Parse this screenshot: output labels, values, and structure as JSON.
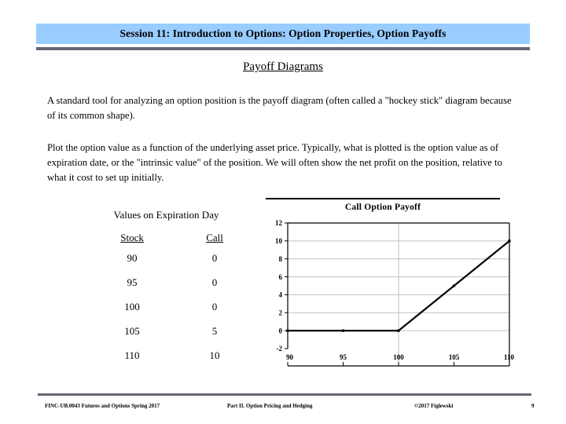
{
  "header": {
    "title": "Session 11:  Introduction to Options: Option Properties, Option Payoffs",
    "banner_color": "#99ccff",
    "rule_color": "#666677"
  },
  "slide": {
    "title": "Payoff Diagrams",
    "paragraphs": [
      "A standard tool for analyzing an option position is the payoff diagram (often called a \"hockey stick\" diagram because of its common shape).",
      "Plot the option value as a function of the underlying asset price.  Typically, what is plotted is the option value as of expiration date, or the \"intrinsic value\" of the position.  We will often show the net profit on the position, relative to what it cost to set up initially."
    ]
  },
  "values_table": {
    "caption": "Values on Expiration Day",
    "columns": [
      "Stock",
      "Call"
    ],
    "rows": [
      [
        "90",
        "0"
      ],
      [
        "95",
        "0"
      ],
      [
        "100",
        "0"
      ],
      [
        "105",
        "5"
      ],
      [
        "110",
        "10"
      ]
    ]
  },
  "chart_data": {
    "type": "line",
    "title": "Call Option Payoff",
    "xlabel": "",
    "ylabel": "",
    "x": [
      90,
      95,
      100,
      105,
      110
    ],
    "values": [
      0,
      0,
      0,
      5,
      10
    ],
    "series": [
      {
        "name": "Call Option Payoff",
        "values": [
          0,
          0,
          0,
          5,
          10
        ]
      }
    ],
    "xlim": [
      90,
      110
    ],
    "ylim": [
      -2,
      12
    ],
    "xticks": [
      90,
      95,
      100,
      105,
      110
    ],
    "xtick_labels": [
      "90",
      "95",
      "100",
      "105",
      "110"
    ],
    "yticks": [
      -2,
      0,
      2,
      4,
      6,
      8,
      10,
      12
    ],
    "ytick_labels": [
      "-2",
      "0",
      "2",
      "4",
      "6",
      "8",
      "10",
      "12"
    ],
    "grid": true,
    "grid_color": "#bfbfbf",
    "line_color": "#000000",
    "marker": "square",
    "legend": false,
    "legend_position": "none"
  },
  "footer": {
    "left": "FINC-UB.0043  Futures and Options   Spring 2017",
    "center": "Part II. Option Pricing and Hedging",
    "right": "©2017 Figlewski",
    "page_number": "9"
  }
}
